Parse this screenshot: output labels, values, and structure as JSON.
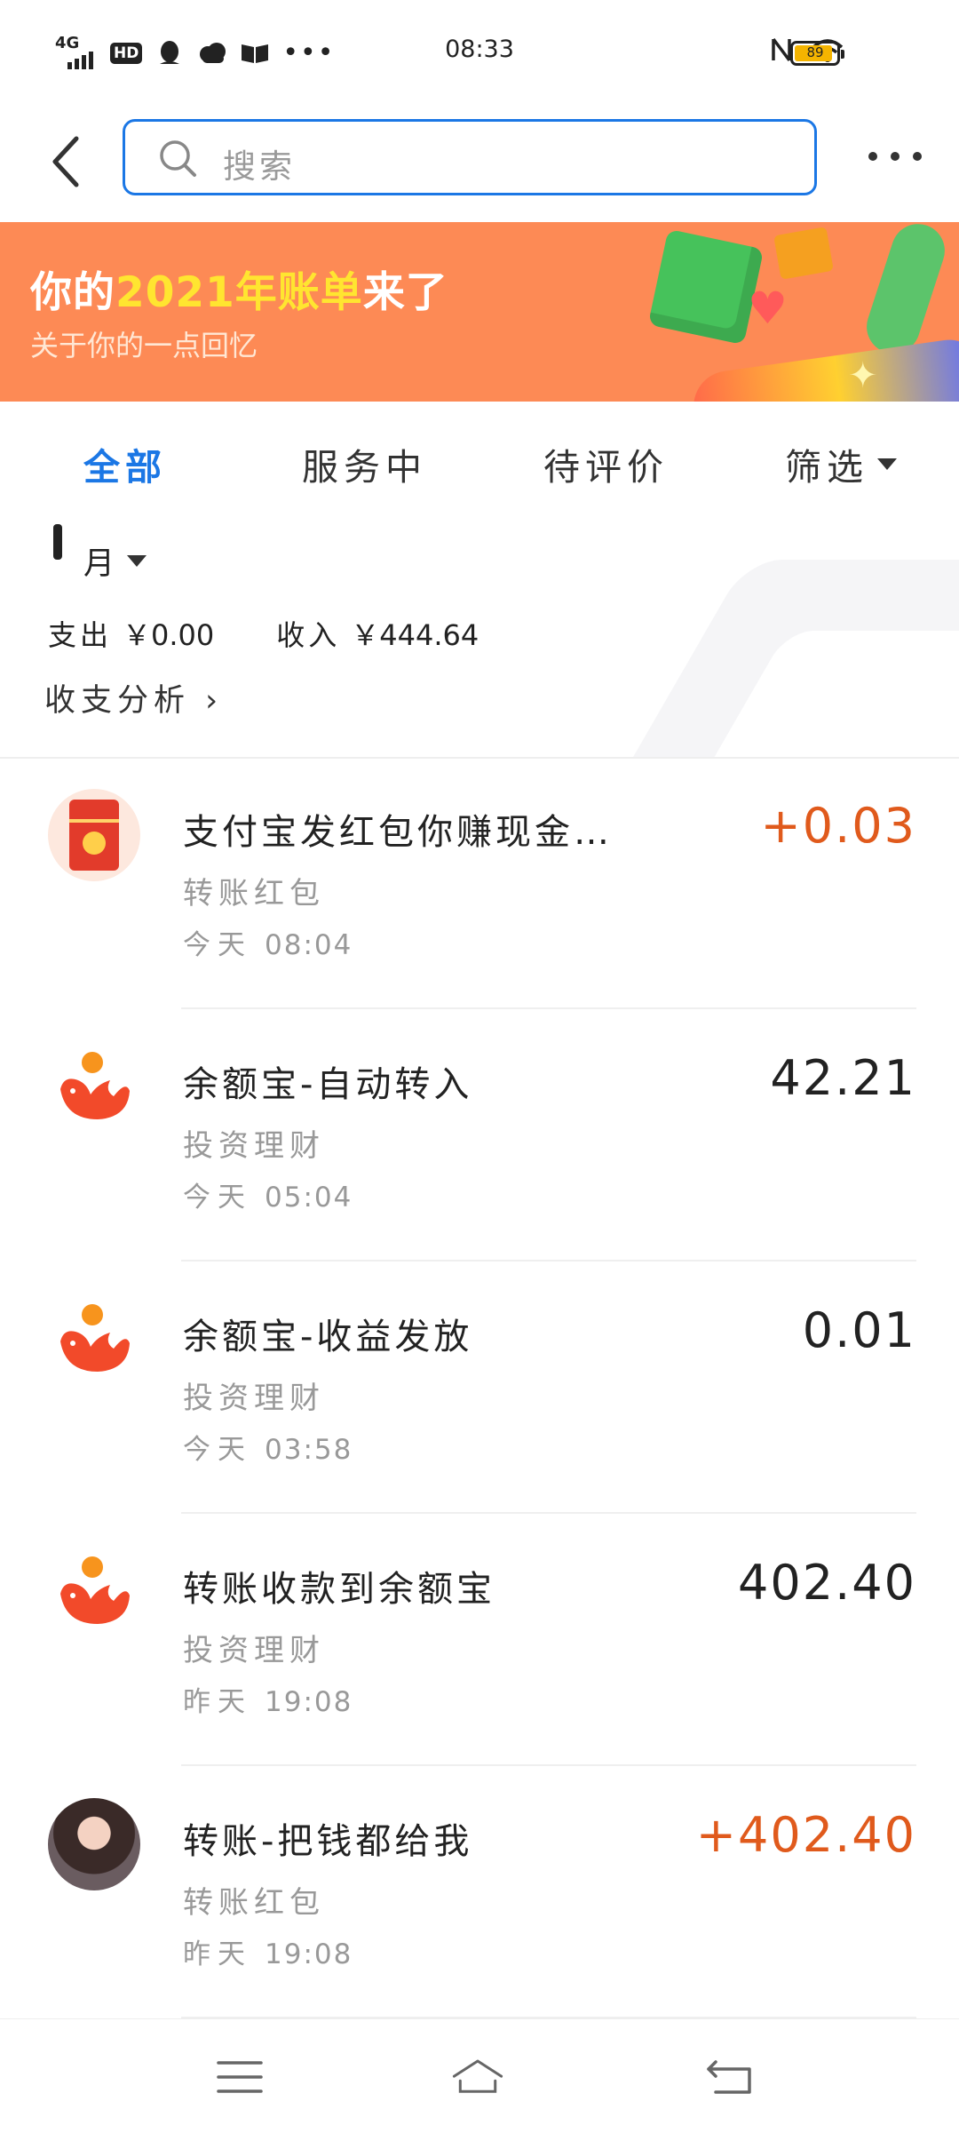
{
  "status_bar": {
    "network": "4G",
    "hd": "HD",
    "time": "08:33",
    "battery": "89",
    "more": "•••"
  },
  "header": {
    "search_placeholder": "搜索"
  },
  "banner": {
    "title_prefix": "你的",
    "title_highlight": "2021年账单",
    "title_suffix": "来了",
    "subtitle": "关于你的一点回忆"
  },
  "tabs": {
    "items": [
      "全部",
      "服务中",
      "待评价"
    ],
    "filter": "筛选",
    "active": "全部"
  },
  "summary": {
    "month": "月",
    "expense_label": "支出",
    "expense_value": "￥0.00",
    "income_label": "收入",
    "income_value": "￥444.64",
    "analysis": "收支分析 ›"
  },
  "transactions": [
    {
      "title": "支付宝发红包你赚现金…",
      "category": "转账红包",
      "day": "今天",
      "time": "08:04",
      "amount": "+0.03",
      "icon": "red-packet-icon"
    },
    {
      "title": "余额宝-自动转入",
      "category": "投资理财",
      "day": "今天",
      "time": "05:04",
      "amount": "42.21",
      "icon": "yuebao-icon"
    },
    {
      "title": "余额宝-收益发放",
      "category": "投资理财",
      "day": "今天",
      "time": "03:58",
      "amount": "0.01",
      "icon": "yuebao-icon"
    },
    {
      "title": "转账收款到余额宝",
      "category": "投资理财",
      "day": "昨天",
      "time": "19:08",
      "amount": "402.40",
      "icon": "yuebao-icon"
    },
    {
      "title": "转账-把钱都给我",
      "category": "转账红包",
      "day": "昨天",
      "time": "19:08",
      "amount": "+402.40",
      "icon": "user-avatar"
    }
  ],
  "colors": {
    "accent": "#1b77e5",
    "banner": "#fd8a55",
    "positive": "#e05a1c"
  }
}
